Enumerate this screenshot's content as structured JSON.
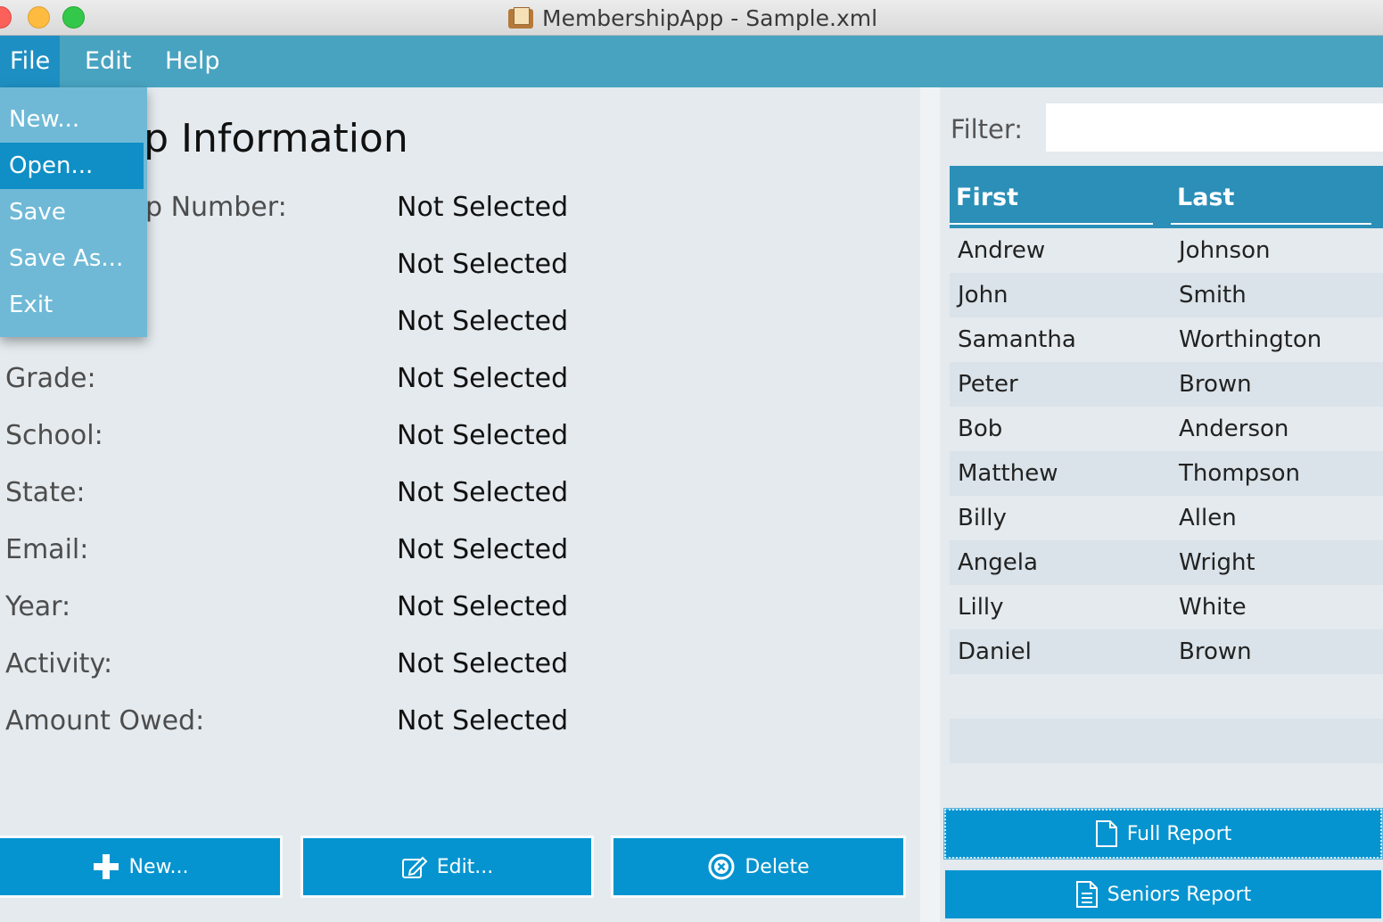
{
  "window": {
    "title": "MembershipApp - Sample.xml"
  },
  "menubar": {
    "file": "File",
    "edit": "Edit",
    "help": "Help"
  },
  "file_menu": {
    "items": [
      {
        "label": "New..."
      },
      {
        "label": "Open..."
      },
      {
        "label": "Save"
      },
      {
        "label": "Save As..."
      },
      {
        "label": "Exit"
      }
    ],
    "selected": "Open..."
  },
  "details": {
    "title_visible": "rship Information",
    "fields": [
      {
        "label": "p Number:",
        "value": "Not Selected"
      },
      {
        "label": "",
        "value": "Not Selected"
      },
      {
        "label": "",
        "value": "Not Selected"
      },
      {
        "label": "Grade:",
        "value": "Not Selected"
      },
      {
        "label": "School:",
        "value": "Not Selected"
      },
      {
        "label": "State:",
        "value": "Not Selected"
      },
      {
        "label": "Email:",
        "value": "Not Selected"
      },
      {
        "label": "Year:",
        "value": "Not Selected"
      },
      {
        "label": "Activity:",
        "value": "Not Selected"
      },
      {
        "label": "Amount Owed:",
        "value": "Not Selected"
      }
    ]
  },
  "actions": {
    "new": "New...",
    "edit": "Edit...",
    "delete": "Delete"
  },
  "filter": {
    "label": "Filter:",
    "value": ""
  },
  "members_table": {
    "headers": {
      "first": "First",
      "last": "Last"
    },
    "rows": [
      {
        "first": "Andrew",
        "last": "Johnson"
      },
      {
        "first": "John",
        "last": "Smith"
      },
      {
        "first": "Samantha",
        "last": "Worthington"
      },
      {
        "first": "Peter",
        "last": "Brown"
      },
      {
        "first": "Bob",
        "last": "Anderson"
      },
      {
        "first": "Matthew",
        "last": "Thompson"
      },
      {
        "first": "Billy",
        "last": "Allen"
      },
      {
        "first": "Angela",
        "last": "Wright"
      },
      {
        "first": "Lilly",
        "last": "White"
      },
      {
        "first": "Daniel",
        "last": "Brown"
      }
    ]
  },
  "reports": {
    "full": "Full Report",
    "seniors": "Seniors Report"
  },
  "colors": {
    "accent": "#0694d0",
    "menubar": "#48a3c0",
    "header": "#2b8fb7"
  }
}
